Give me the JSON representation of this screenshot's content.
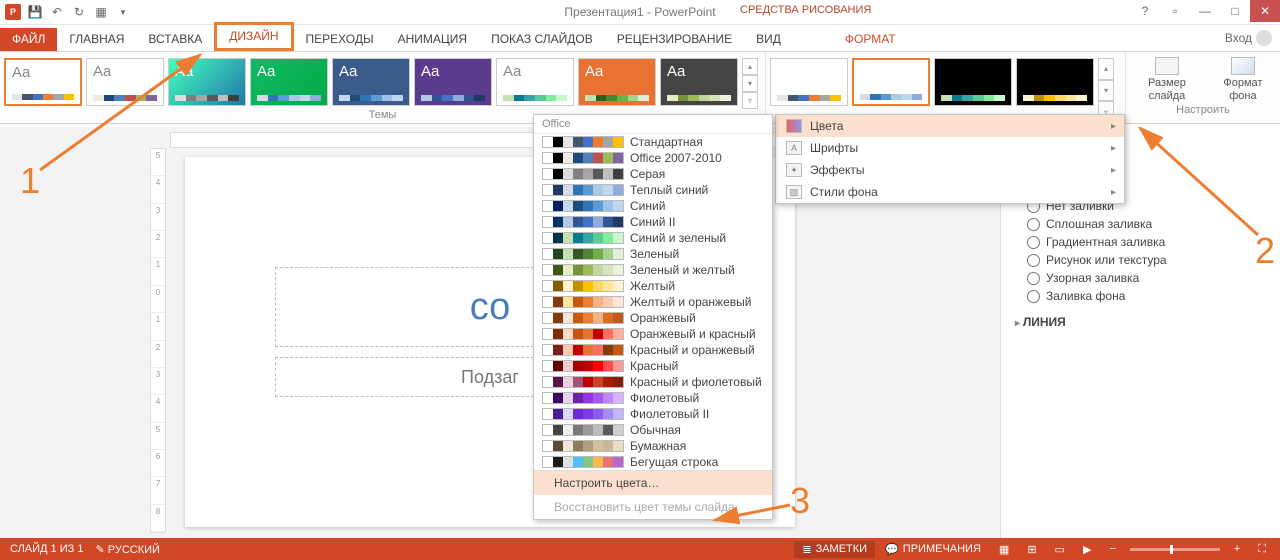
{
  "title": "Презентация1 - PowerPoint",
  "contextual_tools": "СРЕДСТВА РИСОВАНИЯ",
  "login": "Вход",
  "tabs": {
    "file": "ФАЙЛ",
    "home": "ГЛАВНАЯ",
    "insert": "ВСТАВКА",
    "design": "ДИЗАЙН",
    "transitions": "ПЕРЕХОДЫ",
    "animation": "АНИМАЦИЯ",
    "slideshow": "ПОКАЗ СЛАЙДОВ",
    "review": "РЕЦЕНЗИРОВАНИЕ",
    "view": "ВИД",
    "format": "ФОРМАТ"
  },
  "ribbon": {
    "themes_label": "Темы",
    "customize_label": "Настроить",
    "slide_size": "Размер слайда",
    "format_bg": "Формат фона"
  },
  "slide": {
    "title_placeholder": "со",
    "subtitle_placeholder": "Подзаг"
  },
  "scheme_menu": {
    "header": "Office",
    "items": [
      "Стандартная",
      "Office 2007-2010",
      "Серая",
      "Теплый синий",
      "Синий",
      "Синий II",
      "Синий и зеленый",
      "Зеленый",
      "Зеленый и желтый",
      "Желтый",
      "Желтый и оранжевый",
      "Оранжевый",
      "Оранжевый и красный",
      "Красный и оранжевый",
      "Красный",
      "Красный и фиолетовый",
      "Фиолетовый",
      "Фиолетовый II",
      "Обычная",
      "Бумажная",
      "Бегущая строка"
    ],
    "custom": "Настроить цвета…",
    "reset": "Восстановить цвет темы слайда"
  },
  "variants_flyout": {
    "colors": "Цвета",
    "fonts": "Шрифты",
    "effects": "Эффекты",
    "bg_styles": "Стили фона"
  },
  "format_pane": {
    "opt0": "Нет заливки",
    "opt1": "Сплошная заливка",
    "opt2": "Градиентная заливка",
    "opt3": "Рисунок или текстура",
    "opt4": "Узорная заливка",
    "opt5": "Заливка фона",
    "line": "ЛИНИЯ"
  },
  "status": {
    "slide": "СЛАЙД 1 ИЗ 1",
    "lang": "РУССКИЙ",
    "notes": "ЗАМЕТКИ",
    "comments": "ПРИМЕЧАНИЯ"
  },
  "anno": {
    "n1": "1",
    "n2": "2",
    "n3": "3"
  },
  "scheme_palettes": [
    [
      "#fff",
      "#000",
      "#e7e6e6",
      "#44546a",
      "#4472c4",
      "#ed7d31",
      "#a5a5a5",
      "#ffc000"
    ],
    [
      "#fff",
      "#000",
      "#eeece1",
      "#1f497d",
      "#4f81bd",
      "#c0504d",
      "#9bbb59",
      "#8064a2"
    ],
    [
      "#fff",
      "#000",
      "#dcdcdc",
      "#808080",
      "#a6a6a6",
      "#595959",
      "#bfbfbf",
      "#404040"
    ],
    [
      "#fff",
      "#1f3864",
      "#d6dce5",
      "#2e75b6",
      "#5b9bd5",
      "#a9cce3",
      "#bdd7ee",
      "#8faadc"
    ],
    [
      "#fff",
      "#002060",
      "#c5d9f1",
      "#1f4e79",
      "#2e75b6",
      "#5b9bd5",
      "#9dc3e6",
      "#bdd7ee"
    ],
    [
      "#fff",
      "#003366",
      "#b4c7e7",
      "#2f5597",
      "#4472c4",
      "#8faadc",
      "#305496",
      "#1f3864"
    ],
    [
      "#fff",
      "#00344d",
      "#c4e0b4",
      "#0a7a8c",
      "#38a3a5",
      "#57cc99",
      "#80ed99",
      "#c7f9cc"
    ],
    [
      "#fff",
      "#1e4620",
      "#c5e0b4",
      "#385723",
      "#548235",
      "#70ad47",
      "#a9d18e",
      "#e2f0d9"
    ],
    [
      "#fff",
      "#3f5713",
      "#e4eec0",
      "#76923c",
      "#9bbb59",
      "#c3d69b",
      "#d7e4bd",
      "#ebf1de"
    ],
    [
      "#fff",
      "#7f6000",
      "#fff2cc",
      "#bf9000",
      "#ffc000",
      "#ffd966",
      "#ffe699",
      "#fff2cc"
    ],
    [
      "#fff",
      "#833c0c",
      "#ffe699",
      "#c65911",
      "#ed7d31",
      "#f4b183",
      "#f8cbad",
      "#fbe5d6"
    ],
    [
      "#fff",
      "#843c0c",
      "#fbe5d6",
      "#c55a11",
      "#ed7d31",
      "#f4b183",
      "#dd6b20",
      "#bf5a1f"
    ],
    [
      "#fff",
      "#7b2d00",
      "#fddac3",
      "#cf4f16",
      "#e97132",
      "#c00000",
      "#ff6f61",
      "#ffb199"
    ],
    [
      "#fff",
      "#7f1d1d",
      "#f8cbad",
      "#c00000",
      "#e97132",
      "#ff6f61",
      "#843c0c",
      "#c55a11"
    ],
    [
      "#fff",
      "#630000",
      "#f4cccc",
      "#a30000",
      "#c00000",
      "#ff0000",
      "#ff5050",
      "#ff9999"
    ],
    [
      "#fff",
      "#5c1349",
      "#ead1dc",
      "#a64d79",
      "#c00000",
      "#cc4125",
      "#a61c00",
      "#85200c"
    ],
    [
      "#fff",
      "#3b0764",
      "#e6d4ef",
      "#6b21a8",
      "#9333ea",
      "#a855f7",
      "#c084fc",
      "#d8b4fe"
    ],
    [
      "#fff",
      "#4c1d95",
      "#ddd6fe",
      "#6d28d9",
      "#7c3aed",
      "#8b5cf6",
      "#a78bfa",
      "#c4b5fd"
    ],
    [
      "#fff",
      "#444",
      "#eee",
      "#777",
      "#999",
      "#bbb",
      "#595959",
      "#d0cece"
    ],
    [
      "#fff",
      "#5a4a3a",
      "#efe6d9",
      "#8c7b60",
      "#b0a080",
      "#d2c29d",
      "#c7b899",
      "#e8dcc3"
    ],
    [
      "#fff",
      "#1b1b1b",
      "#e0e0e0",
      "#4fc3f7",
      "#81c784",
      "#ffb74d",
      "#e57373",
      "#ba68c8"
    ]
  ]
}
